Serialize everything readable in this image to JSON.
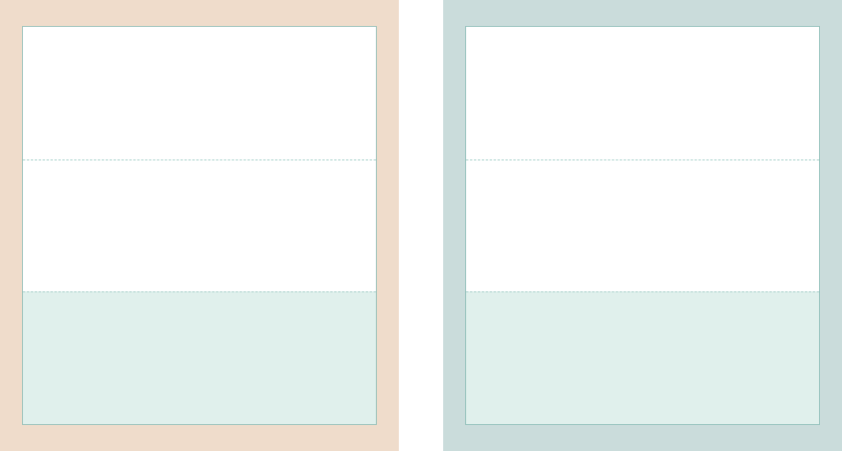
{
  "panels": [
    {
      "id": "left",
      "frame_color": "#efdccb",
      "bands": [
        {
          "id": "top",
          "fill": "#ffffff"
        },
        {
          "id": "middle",
          "fill": "#ffffff"
        },
        {
          "id": "bottom",
          "fill": "#e0f0ec"
        }
      ]
    },
    {
      "id": "right",
      "frame_color": "#cadcdb",
      "bands": [
        {
          "id": "top",
          "fill": "#ffffff"
        },
        {
          "id": "middle",
          "fill": "#ffffff"
        },
        {
          "id": "bottom",
          "fill": "#e0f0ec"
        }
      ]
    }
  ],
  "colors": {
    "sheet_border": "#84b8b2",
    "divider": "#9ccac4"
  }
}
